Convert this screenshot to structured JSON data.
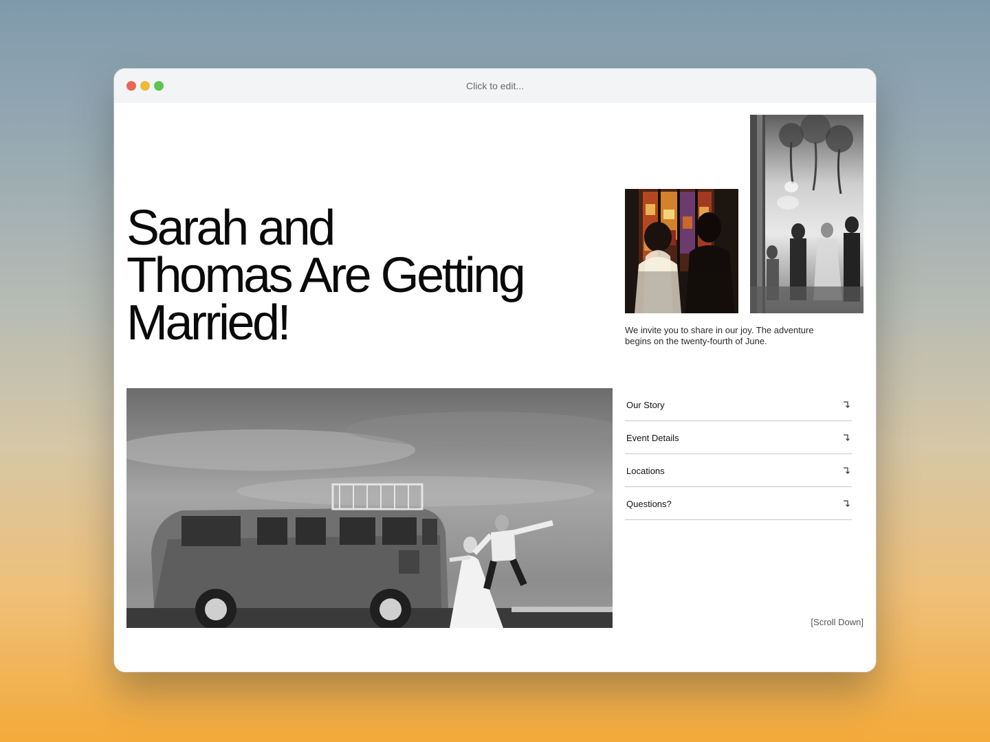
{
  "browser": {
    "address_text": "Click to edit..."
  },
  "hero": {
    "title_lines": [
      "Sarah and",
      "Thomas Are Getting",
      "Married!"
    ]
  },
  "intro": {
    "text": "We invite you to share in our joy. The adventure begins on the twenty-fourth of June."
  },
  "nav": {
    "items": [
      {
        "label": "Our Story",
        "icon": "arrow-down-right-icon"
      },
      {
        "label": "Event Details",
        "icon": "arrow-down-right-icon"
      },
      {
        "label": "Locations",
        "icon": "arrow-down-right-icon"
      },
      {
        "label": "Questions?",
        "icon": "arrow-down-right-icon"
      }
    ]
  },
  "footer": {
    "scroll_hint": "[Scroll Down]"
  },
  "colors": {
    "traffic_red": "#e96557",
    "traffic_yellow": "#eebb39",
    "traffic_green": "#5bc553",
    "text": "#0a0a0a",
    "divider": "#c7c7c7"
  }
}
